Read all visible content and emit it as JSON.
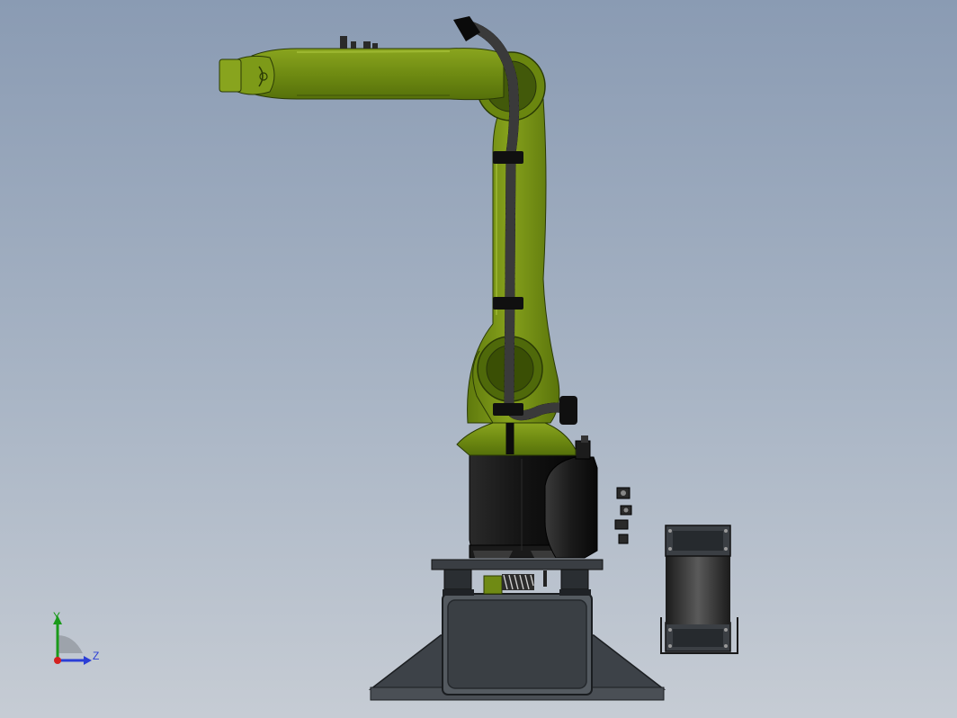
{
  "viewport": {
    "background_top": "#8a9bb3",
    "background_bottom": "#c6ccd4"
  },
  "robot": {
    "arm_color": "#6e8a12",
    "arm_highlight": "#93b02a",
    "base_color": "#111111",
    "cable_color": "#0c0c0c",
    "pedestal_color": "#3f444a",
    "pedestal_edge": "#1e2226"
  },
  "triad": {
    "y_label": "Y",
    "z_label": "Z",
    "y_color": "#1a9a1a",
    "z_color": "#2b3ed6",
    "x_color": "#d42020"
  }
}
